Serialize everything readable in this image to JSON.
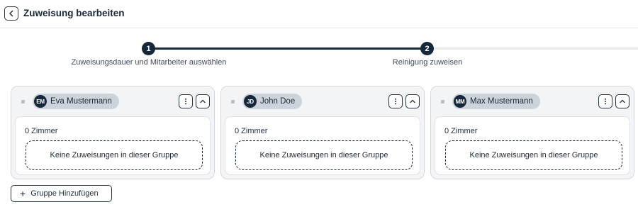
{
  "header": {
    "title": "Zuweisung bearbeiten",
    "back_icon": "chevron-left-icon"
  },
  "stepper": {
    "current_step": 2,
    "steps": [
      {
        "number": "1",
        "label": "Zuweisungsdauer und Mitarbeiter auswählen"
      },
      {
        "number": "2",
        "label": "Reinigung zuweisen"
      }
    ]
  },
  "groups": [
    {
      "initials": "EM",
      "name": "Eva Mustermann",
      "room_count": "0 Zimmer",
      "empty_text": "Keine Zuweisungen in dieser Gruppe"
    },
    {
      "initials": "JD",
      "name": "John Doe",
      "room_count": "0 Zimmer",
      "empty_text": "Keine Zuweisungen in dieser Gruppe"
    },
    {
      "initials": "MM",
      "name": "Max Mustermann",
      "room_count": "0 Zimmer",
      "empty_text": "Keine Zuweisungen in dieser Gruppe"
    }
  ],
  "add_group_label": "Gruppe Hinzufügen",
  "colors": {
    "primary": "#16283b",
    "track_inactive": "#e6eaef",
    "card_bg": "#f2f4f6",
    "chip_bg": "#cdd3da"
  }
}
